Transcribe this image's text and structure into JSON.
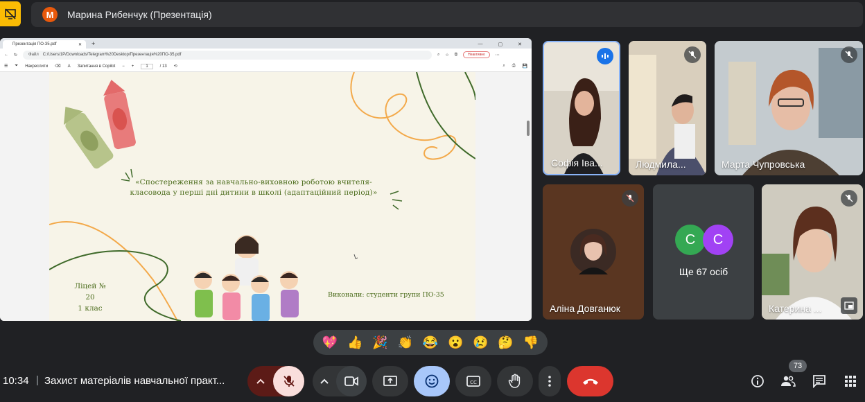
{
  "top": {
    "presenter_initial": "М",
    "presenter_title": "Марина Рибенчук (Презентація)"
  },
  "browser": {
    "tab_title": "Презентація ПО-35.pdf",
    "url_chip": "Файл",
    "url": "C:/Users/1P/Downloads/Telegram%20Desktop/Презентація%20ПО-35.pdf",
    "profile_label": "Неактивно",
    "draw_label": "Накреслити",
    "copilot_label": "Запитання в Copilot",
    "page_current": "1",
    "page_total": "/ 13"
  },
  "slide": {
    "title": "«Спостереження за навчально-виховною роботою вчителя-класовода у перші дні дитини в школі (адаптаційний період)»",
    "school_line1": "Ліцей № 20",
    "school_line2": "1 клас",
    "authors": "Виконали: студенти групи ПО-35"
  },
  "participants": {
    "sofia": "Софія Іва...",
    "ludmila": "Людмила...",
    "marta": "Марта Чупровська",
    "alina": "Аліна Довганюк",
    "kateryna": "Катерина ...",
    "more_a": "С",
    "more_b": "С",
    "more_label": "Ще 67 осіб"
  },
  "reactions": [
    "💖",
    "👍",
    "🎉",
    "👏",
    "😂",
    "😮",
    "😢",
    "🤔",
    "👎"
  ],
  "bottom": {
    "time": "10:34",
    "separator": "|",
    "meeting_title": "Захист матеріалів навчальної практ...",
    "people_count": "73"
  },
  "colors": {
    "accent_blue": "#8ab4f8",
    "hangup_red": "#ea4335",
    "present_yellow": "#fbbc04",
    "more_c1": "#34a853",
    "more_c2": "#a142f4"
  }
}
